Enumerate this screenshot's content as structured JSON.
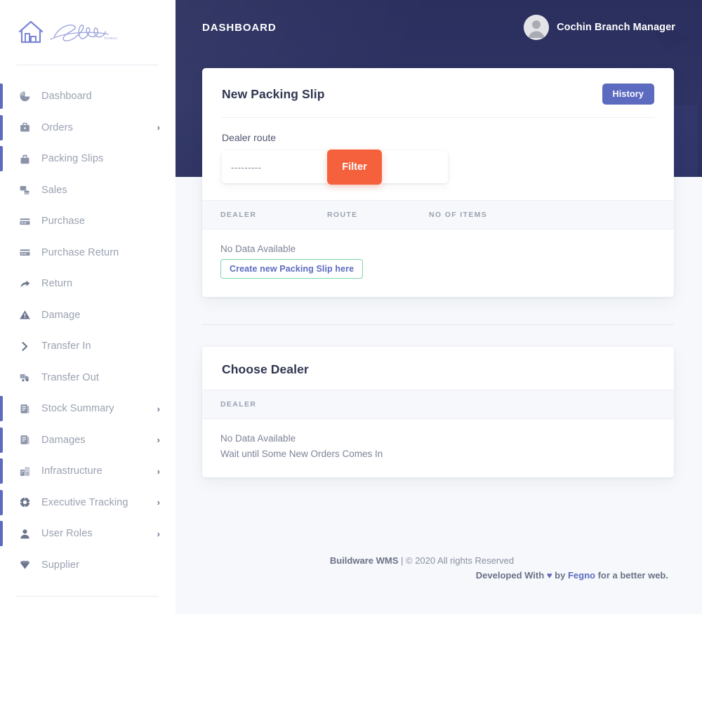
{
  "brand": {
    "logo_name": "Signature",
    "logo_sub": "homes"
  },
  "sidebar": {
    "items": [
      {
        "label": "Dashboard",
        "icon": "pie-chart-icon",
        "chevron": "",
        "accent": true
      },
      {
        "label": "Orders",
        "icon": "briefcase-icon",
        "chevron": "›",
        "accent": true
      },
      {
        "label": "Packing Slips",
        "icon": "inbox-box-icon",
        "chevron": "",
        "accent": true
      },
      {
        "label": "Sales",
        "icon": "sales-coins-icon",
        "chevron": "",
        "accent": false
      },
      {
        "label": "Purchase",
        "icon": "credit-card-icon",
        "chevron": "",
        "accent": false
      },
      {
        "label": "Purchase Return",
        "icon": "credit-card-icon",
        "chevron": "",
        "accent": false
      },
      {
        "label": "Return",
        "icon": "return-arrow-icon",
        "chevron": "",
        "accent": false
      },
      {
        "label": "Damage",
        "icon": "warning-triangle-icon",
        "chevron": "",
        "accent": false
      },
      {
        "label": "Transfer In",
        "icon": "chevron-right-icon",
        "chevron": "",
        "accent": false
      },
      {
        "label": "Transfer Out",
        "icon": "truck-icon",
        "chevron": "",
        "accent": false
      },
      {
        "label": "Stock Summary",
        "icon": "document-list-icon",
        "chevron": "›",
        "accent": true
      },
      {
        "label": "Damages",
        "icon": "document-list-icon",
        "chevron": "›",
        "accent": true
      },
      {
        "label": "Infrastructure",
        "icon": "buildings-icon",
        "chevron": "›",
        "accent": true
      },
      {
        "label": "Executive Tracking",
        "icon": "lifebuoy-icon",
        "chevron": "›",
        "accent": true
      },
      {
        "label": "User Roles",
        "icon": "person-icon",
        "chevron": "›",
        "accent": true
      },
      {
        "label": "Supplier",
        "icon": "diamond-icon",
        "chevron": "",
        "accent": false
      }
    ]
  },
  "header": {
    "title": "DASHBOARD",
    "user_name": "Cochin Branch Manager",
    "avatar_icon": "user-avatar-icon"
  },
  "packing_card": {
    "title": "New Packing Slip",
    "history_label": "History",
    "field_label": "Dealer route",
    "select_value": "---------",
    "select_options": [
      "---------"
    ],
    "filter_label": "Filter",
    "columns": [
      "DEALER",
      "ROUTE",
      "NO OF ITEMS"
    ],
    "empty_text": "No Data Available",
    "create_label": "Create new Packing Slip here"
  },
  "dealer_card": {
    "title": "Choose Dealer",
    "columns": [
      "DEALER"
    ],
    "empty_text": "No Data Available",
    "empty_sub": "Wait until Some New Orders Comes In"
  },
  "footer": {
    "product": "Buildware WMS",
    "separator": "|",
    "copyright": "© 2020 All rights Reserved",
    "dev_prefix": "Developed With",
    "heart": "♥",
    "dev_by": "by",
    "dev_brand": "Fegno",
    "dev_suffix": "for a better web."
  },
  "colors": {
    "accent_indigo": "#5c6bc0",
    "accent_orange": "#f4613c",
    "header_navy": "#2e3363",
    "page_bg": "#f6f8fb",
    "green_border": "#7fd6a8"
  }
}
